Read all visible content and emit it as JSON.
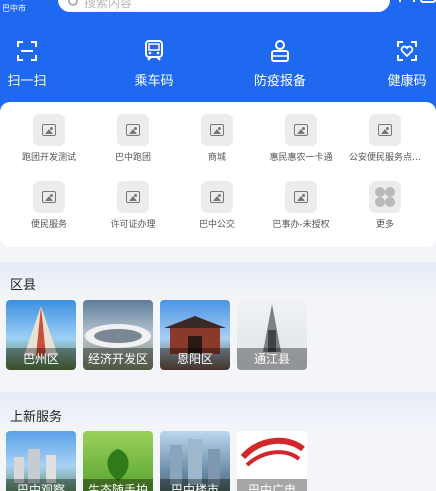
{
  "header": {
    "location": "巴中市",
    "search_placeholder": "搜索内容",
    "quick_actions": [
      {
        "label": "扫一扫",
        "icon": "scan-icon"
      },
      {
        "label": "乘车码",
        "icon": "bus-code-icon"
      },
      {
        "label": "防疫报备",
        "icon": "epidemic-report-icon"
      },
      {
        "label": "健康码",
        "icon": "health-code-icon"
      }
    ]
  },
  "services": [
    {
      "label": "跑团开发测试",
      "icon": "image-placeholder-icon"
    },
    {
      "label": "巴中跑团",
      "icon": "image-placeholder-icon"
    },
    {
      "label": "商城",
      "icon": "image-placeholder-icon"
    },
    {
      "label": "惠民惠农一卡通",
      "icon": "image-placeholder-icon"
    },
    {
      "label": "公安便民服务点…",
      "icon": "image-placeholder-icon"
    },
    {
      "label": "便民服务",
      "icon": "image-placeholder-icon"
    },
    {
      "label": "许可证办理",
      "icon": "image-placeholder-icon"
    },
    {
      "label": "巴中公交",
      "icon": "image-placeholder-icon"
    },
    {
      "label": "巴事办-未授权",
      "icon": "image-placeholder-icon"
    },
    {
      "label": "更多",
      "icon": "more-grid-icon"
    }
  ],
  "districts": {
    "title": "区县",
    "items": [
      {
        "label": "巴州区"
      },
      {
        "label": "经济开发区"
      },
      {
        "label": "恩阳区"
      },
      {
        "label": "通江县"
      }
    ]
  },
  "new_services": {
    "title": "上新服务",
    "items": [
      {
        "label": "巴中观察"
      },
      {
        "label": "生态随手拍"
      },
      {
        "label": "巴中楼市"
      },
      {
        "label": "巴中广电"
      }
    ]
  },
  "colors": {
    "header_blue": "#1e69f0",
    "card_bg": "#ffffff",
    "page_bg": "#f3f5f8"
  }
}
